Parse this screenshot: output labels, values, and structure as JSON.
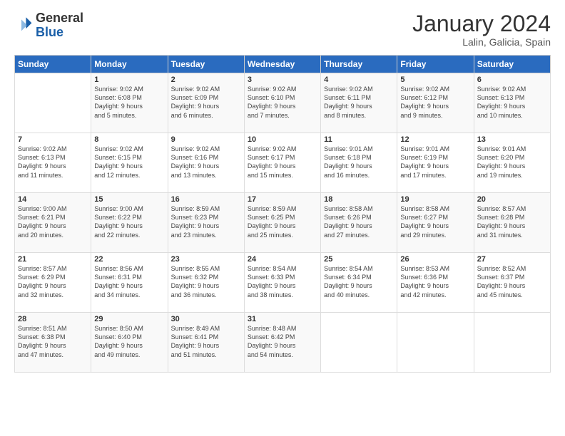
{
  "logo": {
    "line1": "General",
    "line2": "Blue"
  },
  "title": "January 2024",
  "subtitle": "Lalin, Galicia, Spain",
  "header_days": [
    "Sunday",
    "Monday",
    "Tuesday",
    "Wednesday",
    "Thursday",
    "Friday",
    "Saturday"
  ],
  "weeks": [
    [
      {
        "day": "",
        "info": ""
      },
      {
        "day": "1",
        "info": "Sunrise: 9:02 AM\nSunset: 6:08 PM\nDaylight: 9 hours\nand 5 minutes."
      },
      {
        "day": "2",
        "info": "Sunrise: 9:02 AM\nSunset: 6:09 PM\nDaylight: 9 hours\nand 6 minutes."
      },
      {
        "day": "3",
        "info": "Sunrise: 9:02 AM\nSunset: 6:10 PM\nDaylight: 9 hours\nand 7 minutes."
      },
      {
        "day": "4",
        "info": "Sunrise: 9:02 AM\nSunset: 6:11 PM\nDaylight: 9 hours\nand 8 minutes."
      },
      {
        "day": "5",
        "info": "Sunrise: 9:02 AM\nSunset: 6:12 PM\nDaylight: 9 hours\nand 9 minutes."
      },
      {
        "day": "6",
        "info": "Sunrise: 9:02 AM\nSunset: 6:13 PM\nDaylight: 9 hours\nand 10 minutes."
      }
    ],
    [
      {
        "day": "7",
        "info": "Sunrise: 9:02 AM\nSunset: 6:13 PM\nDaylight: 9 hours\nand 11 minutes."
      },
      {
        "day": "8",
        "info": "Sunrise: 9:02 AM\nSunset: 6:15 PM\nDaylight: 9 hours\nand 12 minutes."
      },
      {
        "day": "9",
        "info": "Sunrise: 9:02 AM\nSunset: 6:16 PM\nDaylight: 9 hours\nand 13 minutes."
      },
      {
        "day": "10",
        "info": "Sunrise: 9:02 AM\nSunset: 6:17 PM\nDaylight: 9 hours\nand 15 minutes."
      },
      {
        "day": "11",
        "info": "Sunrise: 9:01 AM\nSunset: 6:18 PM\nDaylight: 9 hours\nand 16 minutes."
      },
      {
        "day": "12",
        "info": "Sunrise: 9:01 AM\nSunset: 6:19 PM\nDaylight: 9 hours\nand 17 minutes."
      },
      {
        "day": "13",
        "info": "Sunrise: 9:01 AM\nSunset: 6:20 PM\nDaylight: 9 hours\nand 19 minutes."
      }
    ],
    [
      {
        "day": "14",
        "info": "Sunrise: 9:00 AM\nSunset: 6:21 PM\nDaylight: 9 hours\nand 20 minutes."
      },
      {
        "day": "15",
        "info": "Sunrise: 9:00 AM\nSunset: 6:22 PM\nDaylight: 9 hours\nand 22 minutes."
      },
      {
        "day": "16",
        "info": "Sunrise: 8:59 AM\nSunset: 6:23 PM\nDaylight: 9 hours\nand 23 minutes."
      },
      {
        "day": "17",
        "info": "Sunrise: 8:59 AM\nSunset: 6:25 PM\nDaylight: 9 hours\nand 25 minutes."
      },
      {
        "day": "18",
        "info": "Sunrise: 8:58 AM\nSunset: 6:26 PM\nDaylight: 9 hours\nand 27 minutes."
      },
      {
        "day": "19",
        "info": "Sunrise: 8:58 AM\nSunset: 6:27 PM\nDaylight: 9 hours\nand 29 minutes."
      },
      {
        "day": "20",
        "info": "Sunrise: 8:57 AM\nSunset: 6:28 PM\nDaylight: 9 hours\nand 31 minutes."
      }
    ],
    [
      {
        "day": "21",
        "info": "Sunrise: 8:57 AM\nSunset: 6:29 PM\nDaylight: 9 hours\nand 32 minutes."
      },
      {
        "day": "22",
        "info": "Sunrise: 8:56 AM\nSunset: 6:31 PM\nDaylight: 9 hours\nand 34 minutes."
      },
      {
        "day": "23",
        "info": "Sunrise: 8:55 AM\nSunset: 6:32 PM\nDaylight: 9 hours\nand 36 minutes."
      },
      {
        "day": "24",
        "info": "Sunrise: 8:54 AM\nSunset: 6:33 PM\nDaylight: 9 hours\nand 38 minutes."
      },
      {
        "day": "25",
        "info": "Sunrise: 8:54 AM\nSunset: 6:34 PM\nDaylight: 9 hours\nand 40 minutes."
      },
      {
        "day": "26",
        "info": "Sunrise: 8:53 AM\nSunset: 6:36 PM\nDaylight: 9 hours\nand 42 minutes."
      },
      {
        "day": "27",
        "info": "Sunrise: 8:52 AM\nSunset: 6:37 PM\nDaylight: 9 hours\nand 45 minutes."
      }
    ],
    [
      {
        "day": "28",
        "info": "Sunrise: 8:51 AM\nSunset: 6:38 PM\nDaylight: 9 hours\nand 47 minutes."
      },
      {
        "day": "29",
        "info": "Sunrise: 8:50 AM\nSunset: 6:40 PM\nDaylight: 9 hours\nand 49 minutes."
      },
      {
        "day": "30",
        "info": "Sunrise: 8:49 AM\nSunset: 6:41 PM\nDaylight: 9 hours\nand 51 minutes."
      },
      {
        "day": "31",
        "info": "Sunrise: 8:48 AM\nSunset: 6:42 PM\nDaylight: 9 hours\nand 54 minutes."
      },
      {
        "day": "",
        "info": ""
      },
      {
        "day": "",
        "info": ""
      },
      {
        "day": "",
        "info": ""
      }
    ]
  ]
}
